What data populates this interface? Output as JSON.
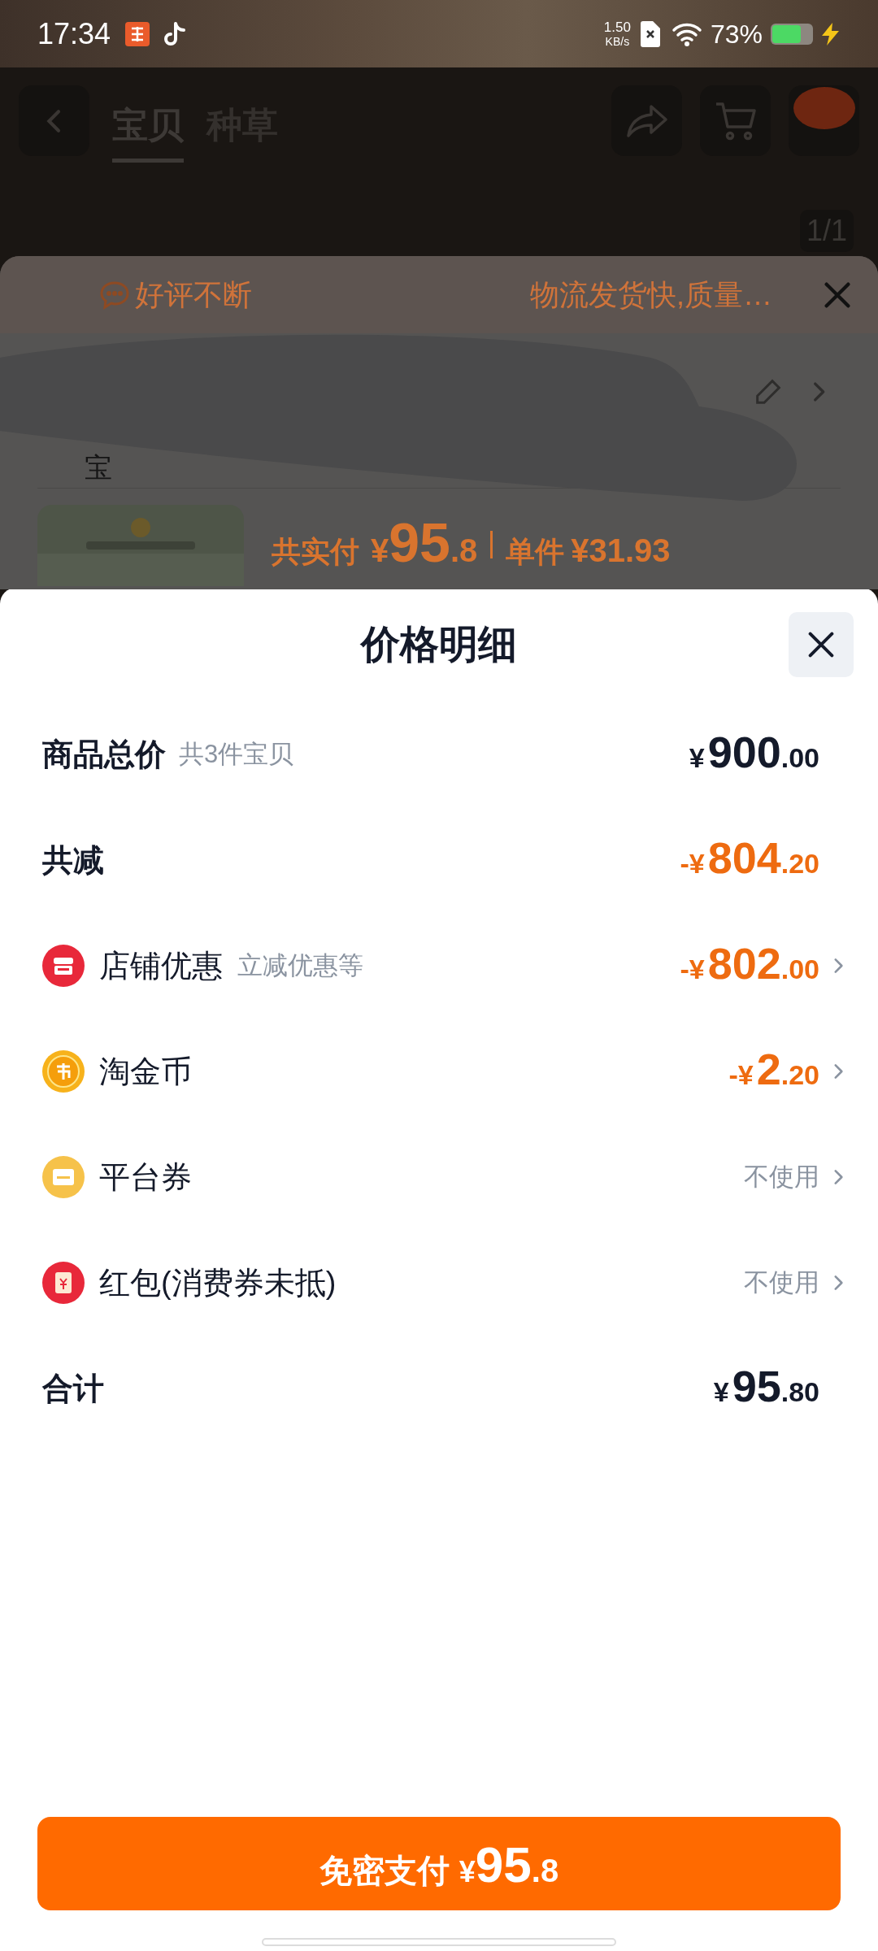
{
  "status_bar": {
    "time": "17:34",
    "net_speed": "1.50",
    "net_unit": "KB/s",
    "battery": "73%",
    "charging": true
  },
  "background": {
    "tabs": [
      {
        "label": "宝贝",
        "selected": true
      },
      {
        "label": "种草",
        "selected": false
      }
    ],
    "image_counter": "1/1",
    "banner_start": "好评不断",
    "banner_end": "物流发货快,质量…",
    "address_tail": "宝",
    "price_label": "共实付",
    "price_currency": "¥",
    "price_integer": "95",
    "price_decimal": ".8",
    "unit_label": "单件",
    "unit_price": "¥31.93"
  },
  "sheet": {
    "title": "价格明细",
    "rows": [
      {
        "kind": "summary",
        "label": "商品总价",
        "sub": "共3件宝贝",
        "value": {
          "kind": "price",
          "discount": false,
          "currency": "¥",
          "integer": "900",
          "decimal": ".00"
        }
      },
      {
        "kind": "summary",
        "label": "共减",
        "value": {
          "kind": "price",
          "discount": true,
          "sign": "-",
          "currency": "¥",
          "integer": "804",
          "decimal": ".20"
        }
      },
      {
        "kind": "shop",
        "label": "店铺优惠",
        "sub": "立减优惠等",
        "value": {
          "kind": "price",
          "discount": true,
          "sign": "-",
          "currency": "¥",
          "integer": "802",
          "decimal": ".00"
        }
      },
      {
        "kind": "coin",
        "label": "淘金币",
        "value": {
          "kind": "price",
          "discount": true,
          "sign": "-",
          "currency": "¥",
          "integer": "2",
          "decimal": ".20"
        }
      },
      {
        "kind": "coupon",
        "label": "平台券",
        "value": {
          "kind": "text",
          "text": "不使用"
        }
      },
      {
        "kind": "envelope",
        "label": "红包(消费券未抵)",
        "value": {
          "kind": "text",
          "text": "不使用"
        }
      },
      {
        "kind": "summary",
        "label": "合计",
        "value": {
          "kind": "price",
          "discount": false,
          "currency": "¥",
          "integer": "95",
          "decimal": ".80"
        }
      }
    ],
    "pay_button": {
      "label": "免密支付",
      "currency": "¥",
      "integer": "95",
      "decimal": ".8"
    }
  }
}
